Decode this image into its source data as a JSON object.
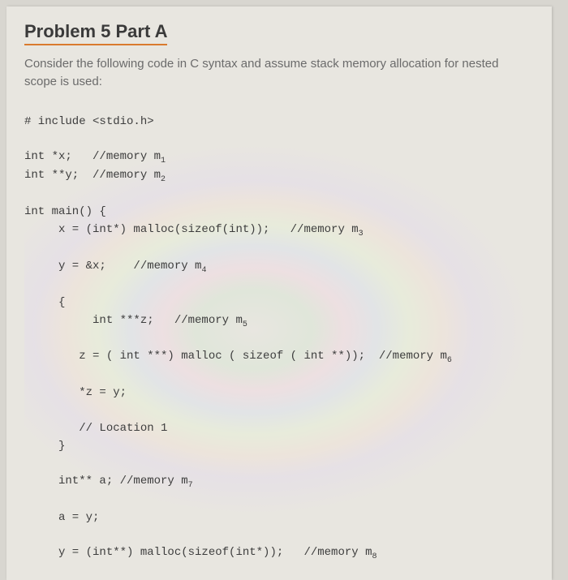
{
  "heading": "Problem 5 Part A",
  "intro": "Consider the following code in C syntax and assume stack memory allocation for nested scope is used:",
  "code": {
    "l01": "# include <stdio.h>",
    "l02": "int *x;   //memory m",
    "l02s": "1",
    "l03": "int **y;  //memory m",
    "l03s": "2",
    "l04": "int main() {",
    "l05": "     x = (int*) malloc(sizeof(int));   //memory m",
    "l05s": "3",
    "l06": "     y = &x;    //memory m",
    "l06s": "4",
    "l07": "     {",
    "l08": "          int ***z;   //memory m",
    "l08s": "5",
    "l09": "        z = ( int ***) malloc ( sizeof ( int **));  //memory m",
    "l09s": "6",
    "l10": "        *z = y;",
    "l11": "        // Location 1",
    "l12": "     }",
    "l13": "     int** a; //memory m",
    "l13s": "7",
    "l14": "     a = y;",
    "l15": "     y = (int**) malloc(sizeof(int*));   //memory m",
    "l15s": "8"
  }
}
